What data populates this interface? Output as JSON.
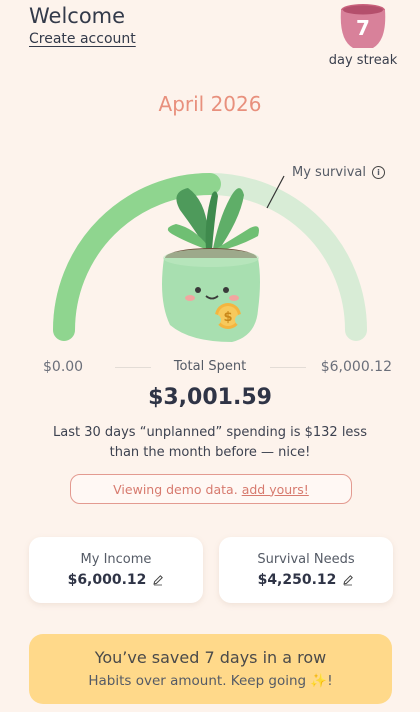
{
  "header": {
    "welcome": "Welcome",
    "create_account": "Create account",
    "streak_count": "7",
    "streak_label": "day streak"
  },
  "month": "April 2026",
  "gauge": {
    "survival_label": "My survival",
    "min_label": "$0.00",
    "max_label": "$6,000.12",
    "total_label": "Total Spent",
    "total_amount": "$3,001.59",
    "progress_fraction": 0.5
  },
  "insight": "Last 30 days “unplanned” spending is $132 less than the month before — nice!",
  "demo": {
    "text": "Viewing demo data.",
    "link": "add yours!"
  },
  "cards": {
    "income_title": "My Income",
    "income_value": "$6,000.12",
    "needs_title": "Survival Needs",
    "needs_value": "$4,250.12"
  },
  "banner": {
    "title": "You’ve saved 7 days in a row",
    "subtitle": "Habits over amount. Keep going ✨!"
  },
  "colors": {
    "accent": "#e8907d",
    "gauge_fill": "#8fd58f",
    "gauge_track": "#d8ecd6",
    "banner": "#ffd98a",
    "background": "#fdf3ec"
  }
}
